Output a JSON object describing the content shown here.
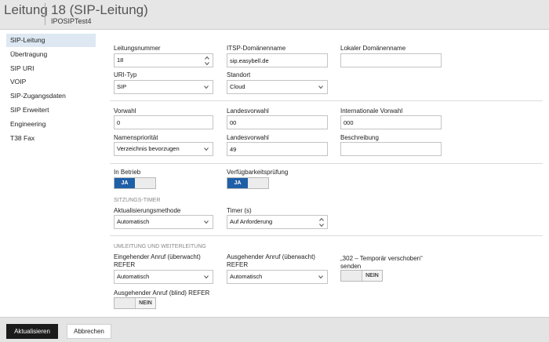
{
  "header": {
    "category": "Leitung",
    "title": "18 (SIP-Leitung)",
    "subtitle": "IPOSIPTest4"
  },
  "sidebar": {
    "items": [
      {
        "label": "SIP-Leitung",
        "active": true
      },
      {
        "label": "Übertragung"
      },
      {
        "label": "SIP URI"
      },
      {
        "label": "VOIP"
      },
      {
        "label": "SIP-Zugangsdaten"
      },
      {
        "label": "SIP Erweitert"
      },
      {
        "label": "Engineering"
      },
      {
        "label": "T38 Fax"
      }
    ]
  },
  "form": {
    "leitungsnummer": {
      "label": "Leitungsnummer",
      "value": "18"
    },
    "itsp_domain": {
      "label": "ITSP-Domänenname",
      "value": "sip.easybell.de"
    },
    "local_domain": {
      "label": "Lokaler Domänenname",
      "value": ""
    },
    "uri_typ": {
      "label": "URI-Typ",
      "value": "SIP"
    },
    "standort": {
      "label": "Standort",
      "value": "Cloud"
    },
    "vorwahl": {
      "label": "Vorwahl",
      "value": "0"
    },
    "landesvorwahl": {
      "label": "Landesvorwahl",
      "value": "00"
    },
    "internationale_vorwahl": {
      "label": "Internationale Vorwahl",
      "value": "000"
    },
    "namensprioritaet": {
      "label": "Namenspriorität",
      "value": "Verzeichnis bevorzugen"
    },
    "landesvorwahl2": {
      "label": "Landesvorwahl",
      "value": "49"
    },
    "beschreibung": {
      "label": "Beschreibung",
      "value": ""
    },
    "in_betrieb": {
      "label": "In Betrieb",
      "state": "JA"
    },
    "verfuegbarkeit": {
      "label": "Verfügbarkeitsprüfung",
      "state": "JA"
    }
  },
  "session_timer": {
    "title": "SITZUNGS-TIMER",
    "methode": {
      "label": "Aktualisierungsmethode",
      "value": "Automatisch"
    },
    "timer": {
      "label": "Timer (s)",
      "value": "Auf Anforderung"
    }
  },
  "forwarding": {
    "title": "UMLEITUNG UND WEITERLEITUNG",
    "incoming": {
      "label_line1": "Eingehender Anruf (überwacht)",
      "label_line2": "REFER",
      "value": "Automatisch"
    },
    "outgoing": {
      "label_line1": "Ausgehender Anruf (überwacht)",
      "label_line2": "REFER",
      "value": "Automatisch"
    },
    "moved": {
      "label_line1": "„302 – Temporär verschoben“",
      "label_line2": "senden",
      "state": "NEIN"
    },
    "blind": {
      "label": "Ausgehender Anruf (blind) REFER",
      "state": "NEIN"
    }
  },
  "footer": {
    "update_label": "Aktualisieren",
    "cancel_label": "Abbrechen"
  },
  "icons": {
    "select": "chevron-down-icon",
    "stepper": "up-down-arrows-icon"
  },
  "colors": {
    "toggle_on": "#1f5fa8",
    "primary_button": "#1b1b1b",
    "active_nav": "#dde8f2"
  }
}
